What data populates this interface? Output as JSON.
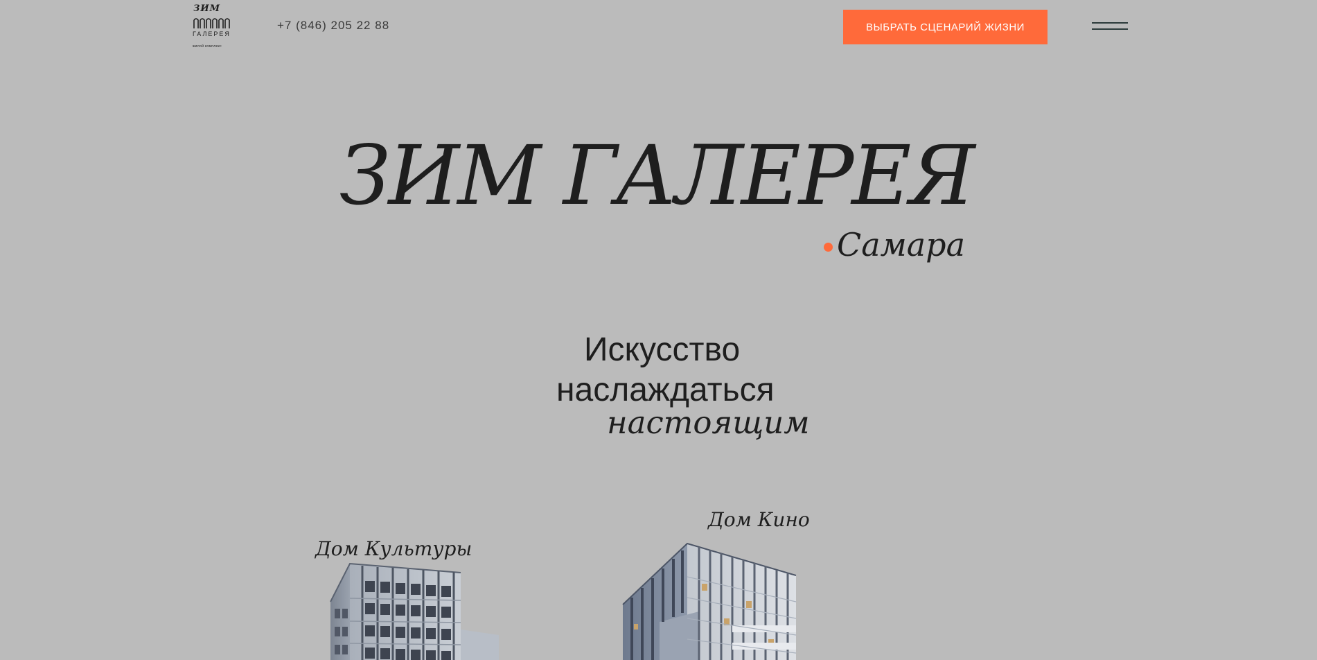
{
  "header": {
    "logo": {
      "line1": "ЗИМ",
      "line2": "ГАЛЕРЕЯ",
      "line3": "жилой комплекс"
    },
    "phone": "+7 (846) 205 22 88",
    "cta_label": "ВЫБРАТЬ СЦЕНАРИЙ ЖИЗНИ",
    "menu_icon": "hamburger-icon"
  },
  "hero": {
    "title": "ЗИМ ГАЛЕРЕЯ",
    "city": "Самара"
  },
  "tagline": {
    "line1": "Искусство",
    "line2": "наслаждаться",
    "line3": "настоящим"
  },
  "buildings": [
    {
      "label": "Дом Культуры"
    },
    {
      "label": "Дом Кино"
    }
  ],
  "colors": {
    "background": "#bbbbbb",
    "accent": "#ff6a3a",
    "text": "#1e1e1e",
    "menu_lines": "#2b3a3a"
  }
}
